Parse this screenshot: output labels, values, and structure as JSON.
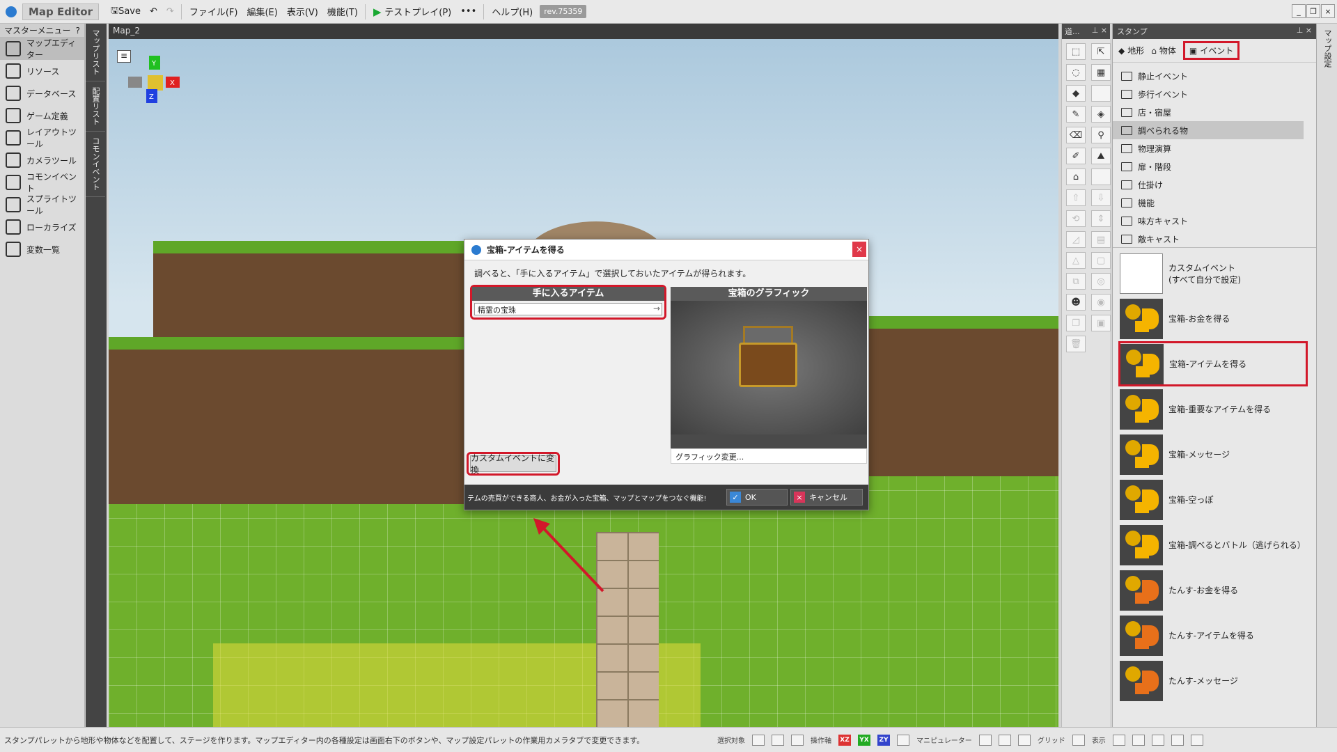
{
  "titlebar": {
    "brand": "Map Editor",
    "save": "Save",
    "menus": [
      "ファイル(F)",
      "編集(E)",
      "表示(V)",
      "機能(T)"
    ],
    "testplay": "テストプレイ(P)",
    "more": "•••",
    "help": "ヘルプ(H)",
    "rev": "rev.75359"
  },
  "leftmenu": {
    "title": "マスターメニュー",
    "help": "?",
    "items": [
      {
        "label": "マップエディター",
        "icon": "map-editor-icon"
      },
      {
        "label": "リソース",
        "icon": "resource-icon"
      },
      {
        "label": "データベース",
        "icon": "database-icon"
      },
      {
        "label": "ゲーム定義",
        "icon": "game-definition-icon"
      },
      {
        "label": "レイアウトツール",
        "icon": "layout-tool-icon"
      },
      {
        "label": "カメラツール",
        "icon": "camera-tool-icon"
      },
      {
        "label": "コモンイベント",
        "icon": "common-event-icon"
      },
      {
        "label": "スプライトツール",
        "icon": "sprite-tool-icon"
      },
      {
        "label": "ローカライズ",
        "icon": "localize-icon"
      },
      {
        "label": "変数一覧",
        "icon": "variable-list-icon"
      }
    ]
  },
  "vtabs": [
    "マップリスト",
    "配置リスト",
    "コモンイベント"
  ],
  "viewport": {
    "title": "Map_2"
  },
  "dialog": {
    "title": "宝箱-アイテムを得る",
    "close": "×",
    "description": "調べると、「手に入るアイテム」で選択しておいたアイテムが得られます。",
    "item_header": "手に入るアイテム",
    "item_value": "精霊の宝珠",
    "graphic_header": "宝箱のグラフィック",
    "graphic_change": "グラフィック変更...",
    "convert": "カスタムイベントに変換",
    "footer_msg": "テムの売買ができる商人、お金が入った宝箱、マップとマップをつなぐ機能!",
    "ok": "OK",
    "cancel": "キャンセル"
  },
  "toolstrip": {
    "title": "道...",
    "pin": "⊥ ×"
  },
  "stamp": {
    "title": "スタンプ",
    "tabs": [
      "地形",
      "物体",
      "イベント"
    ],
    "folders": [
      "静止イベント",
      "歩行イベント",
      "店・宿屋",
      "調べられる物",
      "物理演算",
      "扉・階段",
      "仕掛け",
      "機能",
      "味方キャスト",
      "敵キャスト"
    ],
    "events": [
      {
        "label": "カスタムイベント\n(すべて自分で設定)",
        "style": "custom"
      },
      {
        "label": "宝箱-お金を得る",
        "style": "gold"
      },
      {
        "label": "宝箱-アイテムを得る",
        "style": "gold"
      },
      {
        "label": "宝箱-重要なアイテムを得る",
        "style": "gold"
      },
      {
        "label": "宝箱-メッセージ",
        "style": "gold"
      },
      {
        "label": "宝箱-空っぽ",
        "style": "gold"
      },
      {
        "label": "宝箱-調べるとバトル（逃げられる）",
        "style": "gold"
      },
      {
        "label": "たんす-お金を得る",
        "style": "orange"
      },
      {
        "label": "たんす-アイテムを得る",
        "style": "orange"
      },
      {
        "label": "たんす-メッセージ",
        "style": "orange"
      }
    ]
  },
  "rightstrip": {
    "label": "マップ設定"
  },
  "statusbar": {
    "message": "スタンプパレットから地形や物体などを配置して、ステージを作ります。マップエディター内の各種設定は画面右下のボタンや、マップ設定パレットの作業用カメラタブで変更できます。",
    "select": "選択対象",
    "axis": "操作軸",
    "xz": "XZ",
    "yx": "YX",
    "zy": "ZY",
    "manip": "マニピュレーター",
    "grid": "グリッド",
    "view": "表示"
  },
  "axis": {
    "x": "X",
    "y": "Y",
    "z": "Z"
  },
  "colors": {
    "highlight": "#d2182a",
    "accent": "#2b7bd0"
  }
}
